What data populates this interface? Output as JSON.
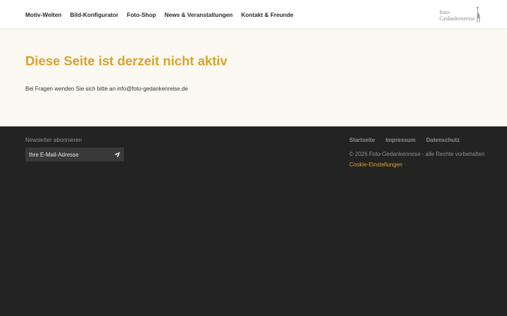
{
  "header": {
    "nav": [
      {
        "label": "Motiv-Welten"
      },
      {
        "label": "Bild-Konfigurator"
      },
      {
        "label": "Foto-Shop"
      },
      {
        "label": "News & Veranstaltungen"
      },
      {
        "label": "Kontakt & Freunde"
      }
    ],
    "logo": {
      "line1": "foto-",
      "line2": "Gedankenreise",
      "icon": "giraffe-figure-icon"
    }
  },
  "main": {
    "title": "Diese Seite ist derzeit nicht aktiv",
    "text": "Bei Fragen wenden Sie sich bitte an info@foto-gedankenreise.de"
  },
  "footer": {
    "newsletter": {
      "label": "Newsletter abonnieren",
      "placeholder": "Ihre E-Mail-Adresse",
      "submit_icon": "paper-plane-icon"
    },
    "links": [
      {
        "label": "Startseite"
      },
      {
        "label": "Impressum"
      },
      {
        "label": "Datenschutz"
      }
    ],
    "copyright": "© 2026 Foto-Gedankenreise - alle Rechte vorbehalten",
    "cookie_settings": "Cookie-Einstellungen"
  },
  "colors": {
    "accent": "#d9a22a",
    "header_bg": "#ffffff",
    "main_bg": "#fcf9f3",
    "footer_bg": "#232323",
    "input_bg": "#393939",
    "footer_text": "#8f8f8f"
  }
}
